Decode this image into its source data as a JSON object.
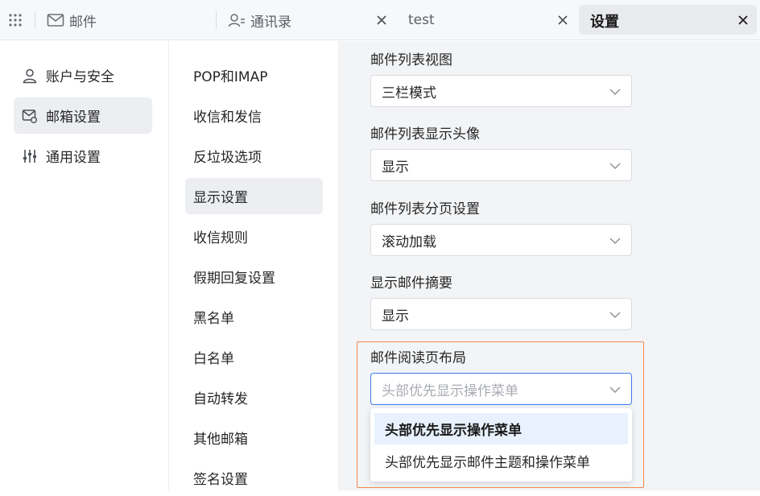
{
  "tabs": [
    {
      "label": "邮件",
      "icon": "mail-icon"
    },
    {
      "label": "通讯录",
      "icon": "contacts-icon"
    },
    {
      "label": "test"
    },
    {
      "label": "设置"
    }
  ],
  "nav_primary": [
    {
      "label": "账户与安全",
      "icon": "user-icon"
    },
    {
      "label": "邮箱设置",
      "icon": "mailbox-settings-icon",
      "active": true
    },
    {
      "label": "通用设置",
      "icon": "sliders-icon"
    }
  ],
  "nav_secondary": [
    {
      "label": "POP和IMAP"
    },
    {
      "label": "收信和发信"
    },
    {
      "label": "反垃圾选项"
    },
    {
      "label": "显示设置",
      "active": true
    },
    {
      "label": "收信规则"
    },
    {
      "label": "假期回复设置"
    },
    {
      "label": "黑名单"
    },
    {
      "label": "白名单"
    },
    {
      "label": "自动转发"
    },
    {
      "label": "其他邮箱"
    },
    {
      "label": "签名设置"
    }
  ],
  "settings": [
    {
      "label": "邮件列表视图",
      "value": "三栏模式"
    },
    {
      "label": "邮件列表显示头像",
      "value": "显示"
    },
    {
      "label": "邮件列表分页设置",
      "value": "滚动加载"
    },
    {
      "label": "显示邮件摘要",
      "value": "显示"
    },
    {
      "label": "邮件阅读页布局",
      "value": "头部优先显示操作菜单"
    }
  ],
  "reading_layout_options": [
    {
      "label": "头部优先显示操作菜单",
      "selected": true
    },
    {
      "label": "头部优先显示邮件主题和操作菜单"
    }
  ],
  "colors": {
    "accent": "#3e7ce8",
    "highlight": "#f08a4b",
    "selected_bg": "#e8f1fd"
  }
}
